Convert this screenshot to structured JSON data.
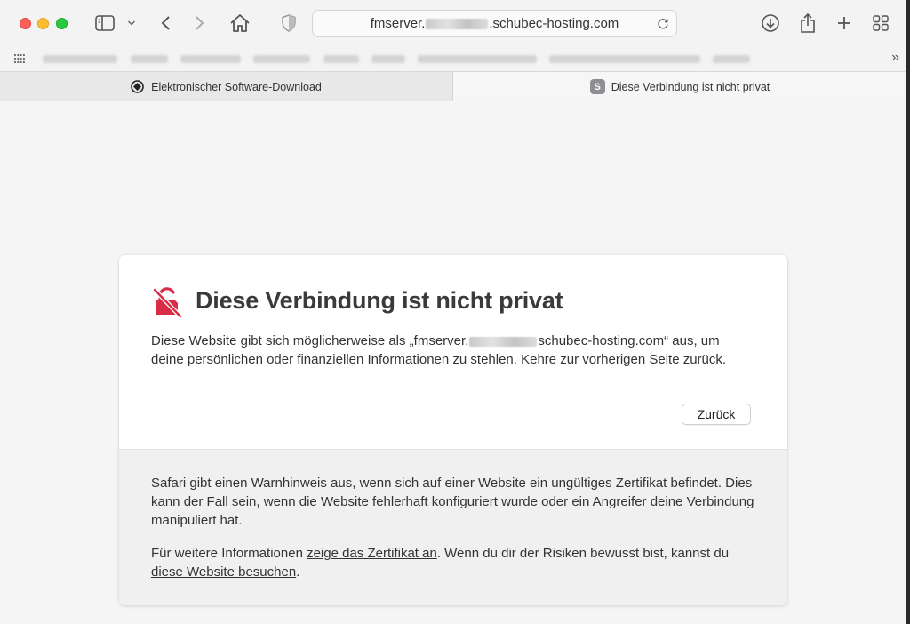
{
  "toolbar": {
    "url_prefix": "fmserver.",
    "url_suffix": ".schubec-hosting.com"
  },
  "tabs": [
    {
      "label": "Elektronischer Software-Download"
    },
    {
      "label": "Diese Verbindung ist nicht privat",
      "favicon_letter": "S"
    }
  ],
  "warning": {
    "title": "Diese Verbindung ist nicht privat",
    "text_before": "Diese Website gibt sich möglicherweise als „fmserver.",
    "text_after": "schubec-hosting.com“ aus, um deine persönlichen oder finanziellen Informationen zu stehlen. Kehre zur vorherigen Seite zurück.",
    "back_button": "Zurück"
  },
  "info": {
    "paragraph1": "Safari gibt einen Warnhinweis aus, wenn sich auf einer Website ein ungültiges Zertifikat befindet. Dies kann der Fall sein, wenn die Website fehlerhaft konfiguriert wurde oder ein Angreifer deine Verbindung manipuliert hat.",
    "p2_before": "Für weitere Informationen ",
    "p2_link1": "zeige das Zertifikat an",
    "p2_middle": ". Wenn du dir der Risiken bewusst bist, kannst du ",
    "p2_link2": "diese Website besuchen",
    "p2_after": "."
  },
  "colors": {
    "warning_icon": "#d92d47",
    "close": "#fe5f57",
    "minimize": "#febc2e",
    "zoom": "#28c840"
  }
}
